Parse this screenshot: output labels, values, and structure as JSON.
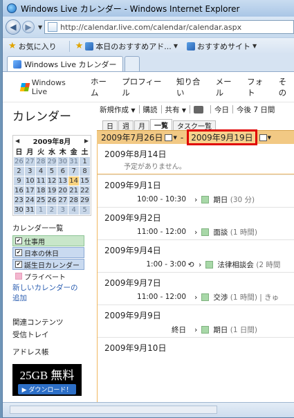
{
  "browser": {
    "title": "Windows Live カレンダー - Windows Internet Explorer",
    "address": "http://calendar.live.com/calendar/calendar.aspx",
    "favorites_label": "お気に入り",
    "fav_items": [
      "本日のおすすめアド...",
      "おすすめサイト"
    ],
    "tab_label": "Windows Live カレンダー"
  },
  "site": {
    "logo": "Windows Live",
    "nav": [
      "ホーム",
      "プロフィール",
      "知り合い",
      "メール",
      "フォト",
      "その"
    ]
  },
  "left": {
    "title": "カレンダー",
    "minical": {
      "month": "2009年8月",
      "weekdays": [
        "日",
        "月",
        "火",
        "水",
        "木",
        "金",
        "土"
      ],
      "weeks": [
        [
          "26",
          "27",
          "28",
          "29",
          "30",
          "31",
          "1"
        ],
        [
          "2",
          "3",
          "4",
          "5",
          "6",
          "7",
          "8"
        ],
        [
          "9",
          "10",
          "11",
          "12",
          "13",
          "14",
          "15"
        ],
        [
          "16",
          "17",
          "18",
          "19",
          "20",
          "21",
          "22"
        ],
        [
          "23",
          "24",
          "25",
          "26",
          "27",
          "28",
          "29"
        ],
        [
          "30",
          "31",
          "1",
          "2",
          "3",
          "4",
          "5"
        ]
      ]
    },
    "calendars_title": "カレンダー一覧",
    "calendars": [
      "仕事用",
      "日本の休日",
      "誕生日カレンダー",
      "プライベート"
    ],
    "new_calendar_link": "新しいカレンダーの追加",
    "related_title": "関連コンテンツ",
    "related": [
      "受信トレイ",
      "アドレス帳"
    ],
    "ad": {
      "headline": "25GB 無料",
      "button": "ダウンロード！"
    }
  },
  "toolbar": {
    "new": "新規作成",
    "subscribe": "購読",
    "share": "共有",
    "today": "今日",
    "next7": "今後 7 日間"
  },
  "view_tabs": [
    "日",
    "週",
    "月",
    "一覧",
    "タスク一覧"
  ],
  "range": {
    "from": "2009年7月26日",
    "to": "2009年9月19日"
  },
  "agenda": [
    {
      "date": "2009年8月14日",
      "empty": "予定がありません。"
    },
    {
      "date": "2009年9月1日",
      "time": "10:00 - 10:30",
      "title": "期日",
      "dur": "(30 分)"
    },
    {
      "date": "2009年9月2日",
      "time": "11:00 - 12:00",
      "title": "面談",
      "dur": "(1 時間)"
    },
    {
      "date": "2009年9月4日",
      "time": "1:00 - 3:00",
      "title": "法律相談会",
      "dur": "(2 時間"
    },
    {
      "date": "2009年9月7日",
      "time": "11:00 - 12:00",
      "title": "交渉",
      "dur": "(1 時間) | きゅ"
    },
    {
      "date": "2009年9月9日",
      "time": "終日",
      "title": "期日",
      "dur": "(1 日間)"
    },
    {
      "date": "2009年9月10日",
      "time": "",
      "title": "",
      "dur": ""
    }
  ]
}
